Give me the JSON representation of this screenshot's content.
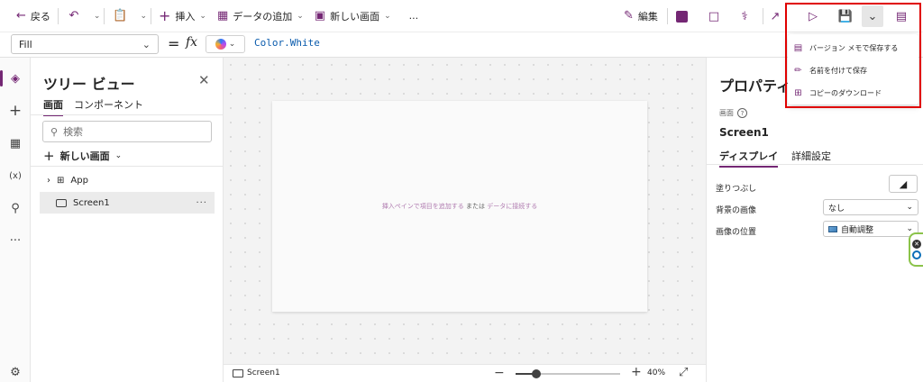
{
  "toolbar": {
    "back": "戻る",
    "insert": "挿入",
    "add_data": "データの追加",
    "new_screen": "新しい画面",
    "more": "...",
    "edit": "編集"
  },
  "formula_bar": {
    "property": "Fill",
    "equals": "=",
    "fx": "fx",
    "formula": "Color.White"
  },
  "tree": {
    "title": "ツリー ビュー",
    "tabs": [
      "画面",
      "コンポーネント"
    ],
    "search_placeholder": "検索",
    "new_screen": "新しい画面",
    "nodes": [
      {
        "label": "App"
      },
      {
        "label": "Screen1"
      }
    ],
    "node_more": "···"
  },
  "canvas": {
    "hint_start": "挿入ペインで項目を追加する",
    "hint_mid": "または",
    "hint_end": "データに接続する"
  },
  "status": {
    "screen": "Screen1",
    "zoom": "40%",
    "zoom_level": 0.4
  },
  "properties": {
    "title": "プロパティ",
    "type_label": "画面",
    "help": "?",
    "name": "Screen1",
    "tabs": [
      "ディスプレイ",
      "詳細設定"
    ],
    "fill_label": "塗りつぶし",
    "bg_image_label": "背景の画像",
    "bg_image_value": "なし",
    "image_pos_label": "画像の位置",
    "image_pos_value": "自動調整"
  },
  "save_menu": {
    "items": [
      {
        "label": "バージョン メモで保存する",
        "icon": "note-save-icon"
      },
      {
        "label": "名前を付けて保存",
        "icon": "save-as-icon"
      },
      {
        "label": "コピーのダウンロード",
        "icon": "download-icon"
      }
    ]
  },
  "colors": {
    "accent": "#742774",
    "highlight": "#e00000"
  }
}
